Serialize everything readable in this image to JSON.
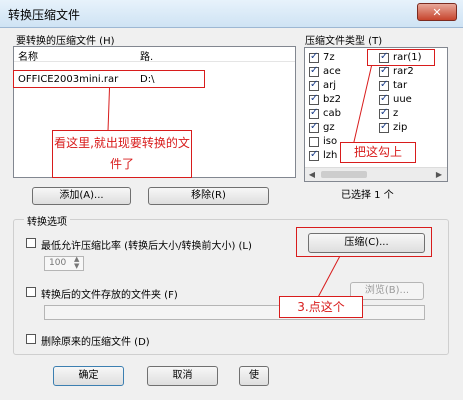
{
  "window": {
    "title": "转换压缩文件",
    "close_glyph": "✕"
  },
  "files": {
    "group_label": "要转换的压缩文件 (H)",
    "columns": [
      "名称",
      "路."
    ],
    "rows": [
      {
        "name": "OFFICE2003mini.rar",
        "path": "D:\\"
      }
    ],
    "add_button": "添加(A)...",
    "remove_button": "移除(R)"
  },
  "types": {
    "group_label": "压缩文件类型 (T)",
    "col1": [
      {
        "label": "7z",
        "checked": true
      },
      {
        "label": "ace",
        "checked": true
      },
      {
        "label": "arj",
        "checked": true
      },
      {
        "label": "bz2",
        "checked": true
      },
      {
        "label": "cab",
        "checked": true
      },
      {
        "label": "gz",
        "checked": true
      },
      {
        "label": "iso",
        "checked": false
      },
      {
        "label": "lzh",
        "checked": true
      }
    ],
    "col2": [
      {
        "label": "rar(1)",
        "checked": true
      },
      {
        "label": "rar2",
        "checked": true
      },
      {
        "label": "tar",
        "checked": true
      },
      {
        "label": "uue",
        "checked": true
      },
      {
        "label": "z",
        "checked": true
      },
      {
        "label": "zip",
        "checked": true
      }
    ],
    "selected_count": "已选择 1 个"
  },
  "options": {
    "group_label": "转换选项",
    "min_ratio_label": "最低允许压缩比率 (转换后大小/转换前大小) (L)",
    "ratio_value": "100",
    "compress_button": "压缩(C)...",
    "folder_label": "转换后的文件存放的文件夹 (F)",
    "browse_button": "浏览(B)...",
    "delete_label": "删除原来的压缩文件 (D)"
  },
  "footer": {
    "ok_button": "确定",
    "cancel_button": "取消",
    "help_button": "使"
  },
  "annotations": {
    "note1": "看这里,就出现要转换的文件了",
    "note2": "把这勾上",
    "note3": "3.点这个"
  },
  "colors": {
    "annotation": "#d81c1c"
  }
}
